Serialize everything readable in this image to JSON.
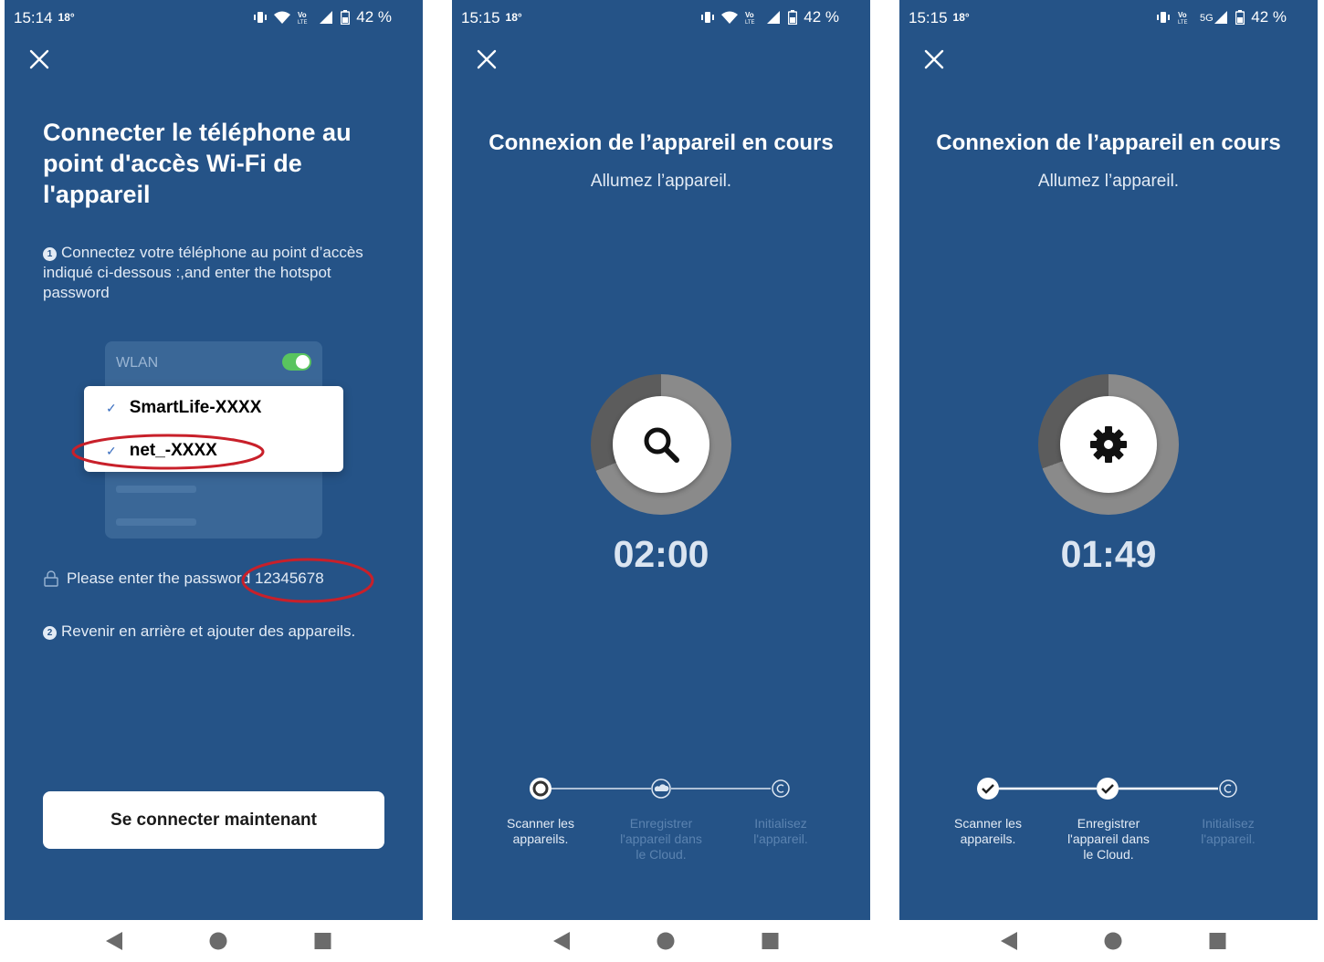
{
  "panels": [
    {
      "status": {
        "time": "15:14",
        "temp": "18°",
        "battery": "42 %"
      },
      "title": "Connecter le téléphone au point d'accès Wi-Fi de l'appareil",
      "step1_number": "1",
      "step1": "Connectez votre téléphone au point d’accès indiqué ci-dessous :,and enter the hotspot password",
      "wlan_label": "WLAN",
      "networks": [
        "SmartLife-XXXX",
        "net_-XXXX"
      ],
      "password_text": "Please enter the password 12345678",
      "step2_number": "2",
      "step2": "Revenir en arrière et ajouter des appareils.",
      "button": "Se connecter maintenant",
      "highlight_color": "#c8202a"
    },
    {
      "status": {
        "time": "15:15",
        "temp": "18°",
        "battery": "42 %"
      },
      "title": "Connexion de l’appareil en cours",
      "subtitle": "Allumez l’appareil.",
      "icon": "search-icon",
      "timer": "02:00",
      "steps": [
        "Scanner les appareils.",
        "Enregistrer l'appareil dans le Cloud.",
        "Initialisez l'appareil."
      ]
    },
    {
      "status": {
        "time": "15:15",
        "temp": "18°",
        "battery": "42 %"
      },
      "title": "Connexion de l’appareil en cours",
      "subtitle": "Allumez l’appareil.",
      "icon": "gear-icon",
      "timer": "01:49",
      "steps": [
        "Scanner les appareils.",
        "Enregistrer l'appareil dans le Cloud.",
        "Initialisez l'appareil."
      ]
    }
  ],
  "colors": {
    "background": "#255387",
    "accent_green": "#59c45f",
    "dim_text": "#5b83b0"
  }
}
